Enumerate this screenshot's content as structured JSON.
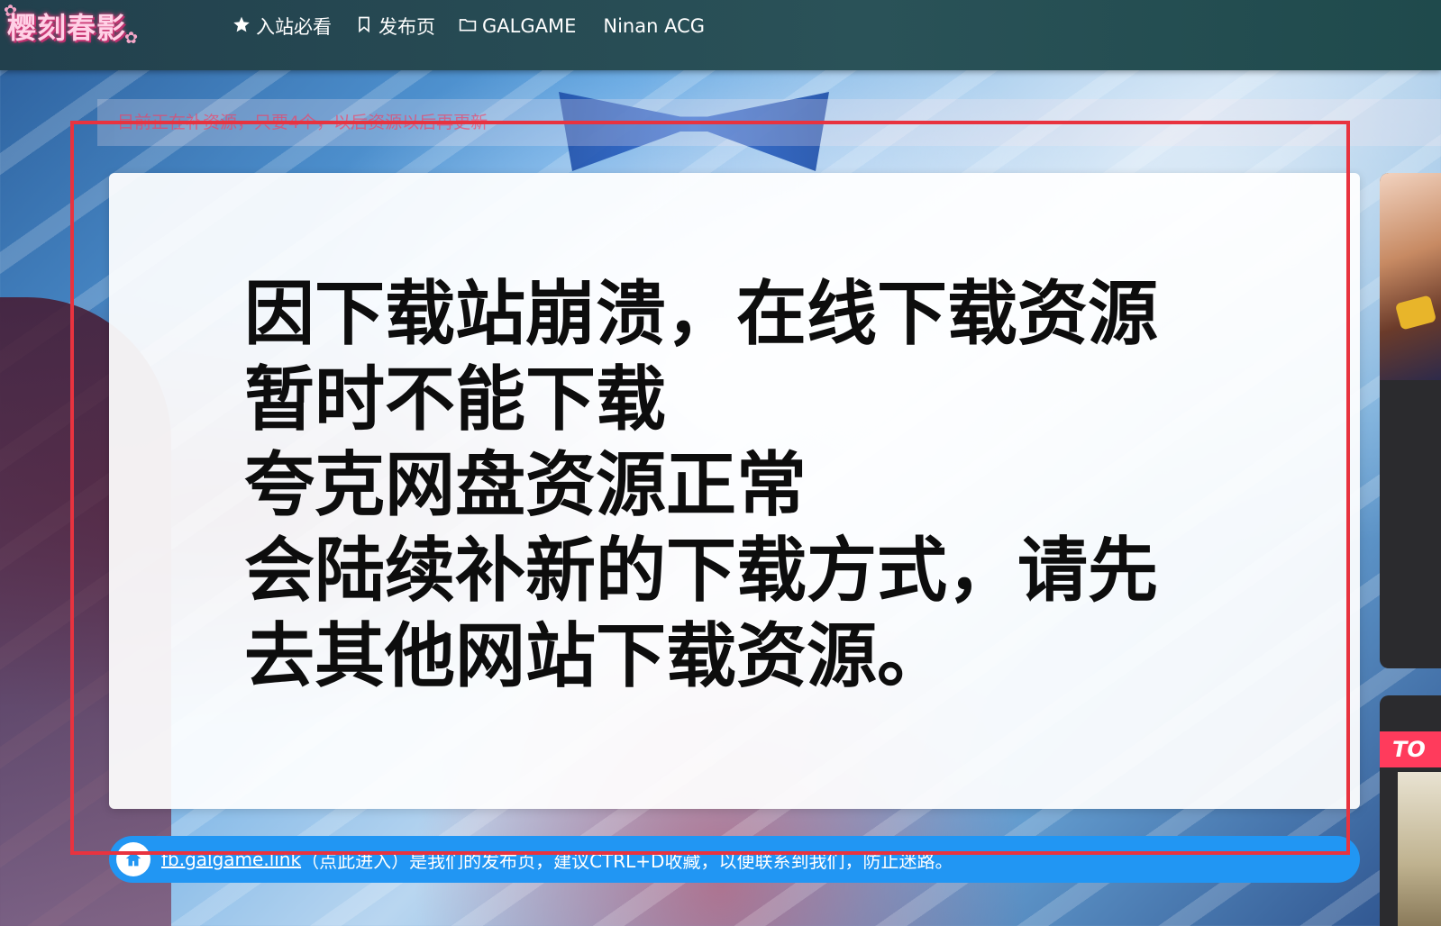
{
  "header": {
    "logo_text": "樱刻春影",
    "nav": [
      {
        "label": "入站必看",
        "icon": "star-icon"
      },
      {
        "label": "发布页",
        "icon": "bookmark-icon"
      },
      {
        "label": "GALGAME",
        "icon": "folder-icon"
      },
      {
        "label": "Ninan ACG",
        "icon": ""
      }
    ]
  },
  "notice": {
    "text": "目前正在补资源，只要4个，以后资源以后再更新"
  },
  "announcement": {
    "lines": [
      "因下载站崩溃，在线下载资源",
      "暂时不能下载",
      "夸克网盘资源正常",
      "会陆续补新的下载方式，请先",
      "去其他网站下载资源。"
    ]
  },
  "info_bar": {
    "link_text": "fb.galgame.link",
    "text": "（点此进入）是我们的发布页，建议CTRL+D收藏，以便联系到我们，防止迷路。"
  },
  "sidebar": {
    "badge_text": "TO"
  },
  "colors": {
    "header_bg": "#2a5258",
    "info_bar_bg": "#2196f3",
    "highlight_border": "#e8333f",
    "notice_text": "#ff4f6e",
    "badge_bg": "#ff3b5c"
  }
}
